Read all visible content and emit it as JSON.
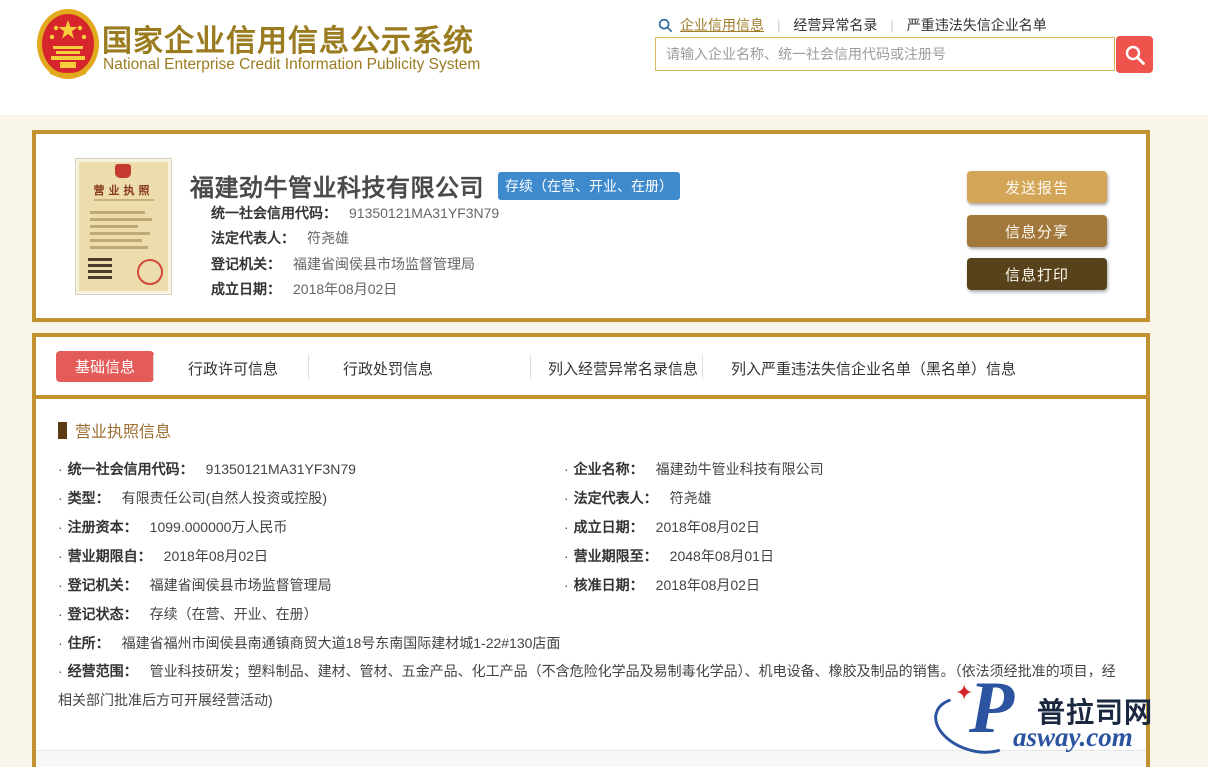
{
  "colors": {
    "brand_gold_text": "#9A7B20",
    "card_border_gold": "#C1922F",
    "status_badge_blue": "#3E8ACC",
    "active_tab_red": "#E35C5A",
    "search_button_red": "#EE544C",
    "button_report": "#D3A556",
    "button_share": "#A2773B",
    "button_print": "#57421B",
    "section_title_brown": "#9C6D31",
    "page_background": "#FAF5EA"
  },
  "header": {
    "title_cn": "国家企业信用信息公示系统",
    "title_en": "National Enterprise Credit Information Publicity System",
    "nav": {
      "item1": "企业信用信息",
      "item2": "经营异常名录",
      "item3": "严重违法失信企业名单"
    },
    "search_placeholder": "请输入企业名称、统一社会信用代码或注册号"
  },
  "summary": {
    "license_thumb_title": "营业执照",
    "company_name": "福建劲牛管业科技有限公司",
    "status_badge": "存续（在营、开业、在册）",
    "fields": [
      {
        "label": "统一社会信用代码：",
        "value": "91350121MA31YF3N79"
      },
      {
        "label": "法定代表人：",
        "value": "符尧雄"
      },
      {
        "label": "登记机关：",
        "value": "福建省闽侯县市场监督管理局"
      },
      {
        "label": "成立日期：",
        "value": "2018年08月02日"
      }
    ],
    "buttons": {
      "report": "发送报告",
      "share": "信息分享",
      "print": "信息打印"
    }
  },
  "tabs": {
    "tab1": "基础信息",
    "tab2": "行政许可信息",
    "tab3": "行政处罚信息",
    "tab4": "列入经营异常名录信息",
    "tab5": "列入严重违法失信企业名单（黑名单）信息"
  },
  "license_section": {
    "title": "营业执照信息",
    "left": [
      {
        "label": "统一社会信用代码：",
        "value": "91350121MA31YF3N79"
      },
      {
        "label": "类型：",
        "value": "有限责任公司(自然人投资或控股)"
      },
      {
        "label": "注册资本：",
        "value": "1099.000000万人民币"
      },
      {
        "label": "营业期限自：",
        "value": "2018年08月02日"
      },
      {
        "label": "登记机关：",
        "value": "福建省闽侯县市场监督管理局"
      },
      {
        "label": "登记状态：",
        "value": "存续（在营、开业、在册）"
      },
      {
        "label": "住所：",
        "value": "福建省福州市闽侯县南通镇商贸大道18号东南国际建材城1-22#130店面"
      }
    ],
    "right": [
      {
        "label": "企业名称：",
        "value": "福建劲牛管业科技有限公司"
      },
      {
        "label": "法定代表人：",
        "value": "符尧雄"
      },
      {
        "label": "成立日期：",
        "value": "2018年08月02日"
      },
      {
        "label": "营业期限至：",
        "value": "2048年08月01日"
      },
      {
        "label": "核准日期：",
        "value": "2018年08月02日"
      }
    ],
    "scope": {
      "label": "经营范围：",
      "value": "管业科技研发；塑料制品、建材、管材、五金产品、化工产品（不含危险化学品及易制毒化学品）、机电设备、橡胶及制品的销售。（依法须经批准的项目，经相关部门批准后方可开展经营活动)"
    }
  },
  "watermark": {
    "latin_p": "P",
    "cn": "普拉司网",
    "latin_rest": "asway.com"
  }
}
